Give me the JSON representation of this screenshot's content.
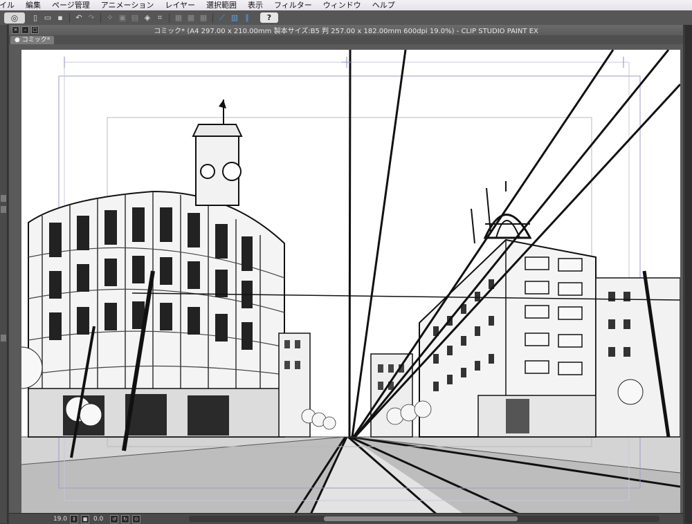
{
  "menubar": {
    "items": [
      "イル",
      "編集",
      "ページ管理",
      "アニメーション",
      "レイヤー",
      "選択範囲",
      "表示",
      "フィルター",
      "ウィンドウ",
      "ヘルプ"
    ]
  },
  "toolbar": {
    "icons": [
      "app-icon",
      "new-file-icon",
      "open-file-icon",
      "save-icon",
      "undo-icon",
      "redo-icon",
      "selection-icon",
      "transform-icon",
      "fill-icon",
      "crop-icon",
      "snap-ruler-icon",
      "snap-grid-icon",
      "snap-special-ruler-icon",
      "help-icon"
    ],
    "help_label": "?"
  },
  "document": {
    "title": "コミック* (A4 297.00 x 210.00mm 製本サイズ:B5 判 257.00 x 182.00mm 600dpi 19.0%)  - CLIP STUDIO PAINT EX",
    "tab_label": "コミック*"
  },
  "statusbar": {
    "zoom": "19.0",
    "rotation": "0.0"
  },
  "colors": {
    "menubar_bg": "#ece8ef",
    "toolbar_bg": "#565656",
    "canvas_bg": "#5a5a5a",
    "paper": "#ffffff",
    "accent": "#5aa0e6"
  }
}
